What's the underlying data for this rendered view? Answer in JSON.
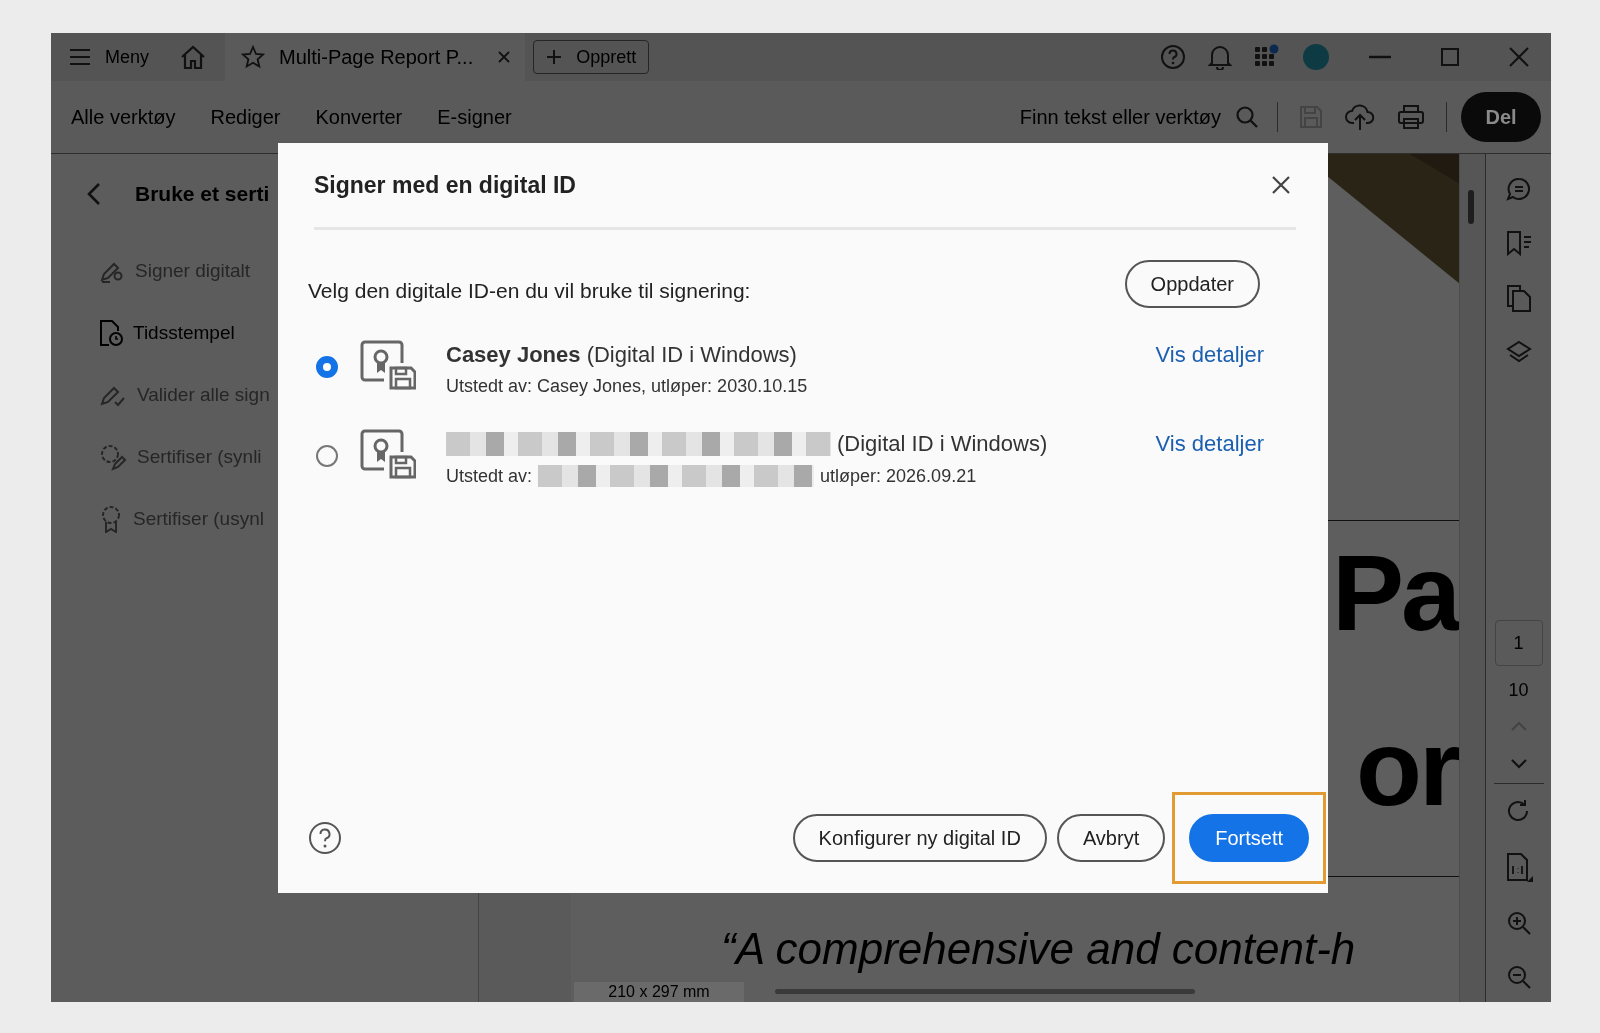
{
  "title_bar": {
    "menu_label": "Meny",
    "tab_title": "Multi-Page Report P...",
    "create_button": "Opprett"
  },
  "toolbar": {
    "items": [
      "Alle verktøy",
      "Rediger",
      "Konverter",
      "E-signer"
    ],
    "search_label": "Finn tekst eller verktøy",
    "share_button": "Del"
  },
  "side_panel": {
    "title": "Bruke et serti",
    "items": [
      {
        "label": "Signer digitalt",
        "kind": "sign",
        "disabled": true
      },
      {
        "label": "Tidsstempel",
        "kind": "timestamp",
        "disabled": false
      },
      {
        "label": "Valider alle sign",
        "kind": "validate",
        "disabled": true
      },
      {
        "label": "Sertifiser (synli",
        "kind": "certify-visible",
        "disabled": true
      },
      {
        "label": "Sertifiser (usynl",
        "kind": "certify-invisible",
        "disabled": true
      }
    ]
  },
  "document": {
    "heading_fragments": [
      "Pa",
      "or"
    ],
    "quote": "“A comprehensive and content-h",
    "page_size": "210 x 297 mm"
  },
  "page_nav": {
    "current": "1",
    "total": "10"
  },
  "dialog": {
    "title": "Signer med en digital ID",
    "prompt": "Velg den digitale ID-en du vil bruke til signering:",
    "refresh_button": "Oppdater",
    "ids": [
      {
        "selected": true,
        "redacted": false,
        "name": "**Casey Jones** (Digital ID i Windows)",
        "issued_label": "Utstedt av:",
        "issuer": "Casey Jones,",
        "expiry": "utløper: 2030.10.15",
        "details_link": "Vis detaljer"
      },
      {
        "selected": false,
        "redacted": true,
        "name": "(Digital ID i Windows)",
        "issued_label": "Utstedt av:",
        "expiry": "utløper: 2026.09.21",
        "details_link": "Vis detaljer"
      }
    ],
    "buttons": [
      {
        "label": "Konfigurer ny digital ID",
        "kind": "secondary",
        "highlighted": false
      },
      {
        "label": "Avbryt",
        "kind": "secondary",
        "highlighted": false
      },
      {
        "label": "Fortsett",
        "kind": "primary",
        "highlighted": true
      }
    ]
  }
}
